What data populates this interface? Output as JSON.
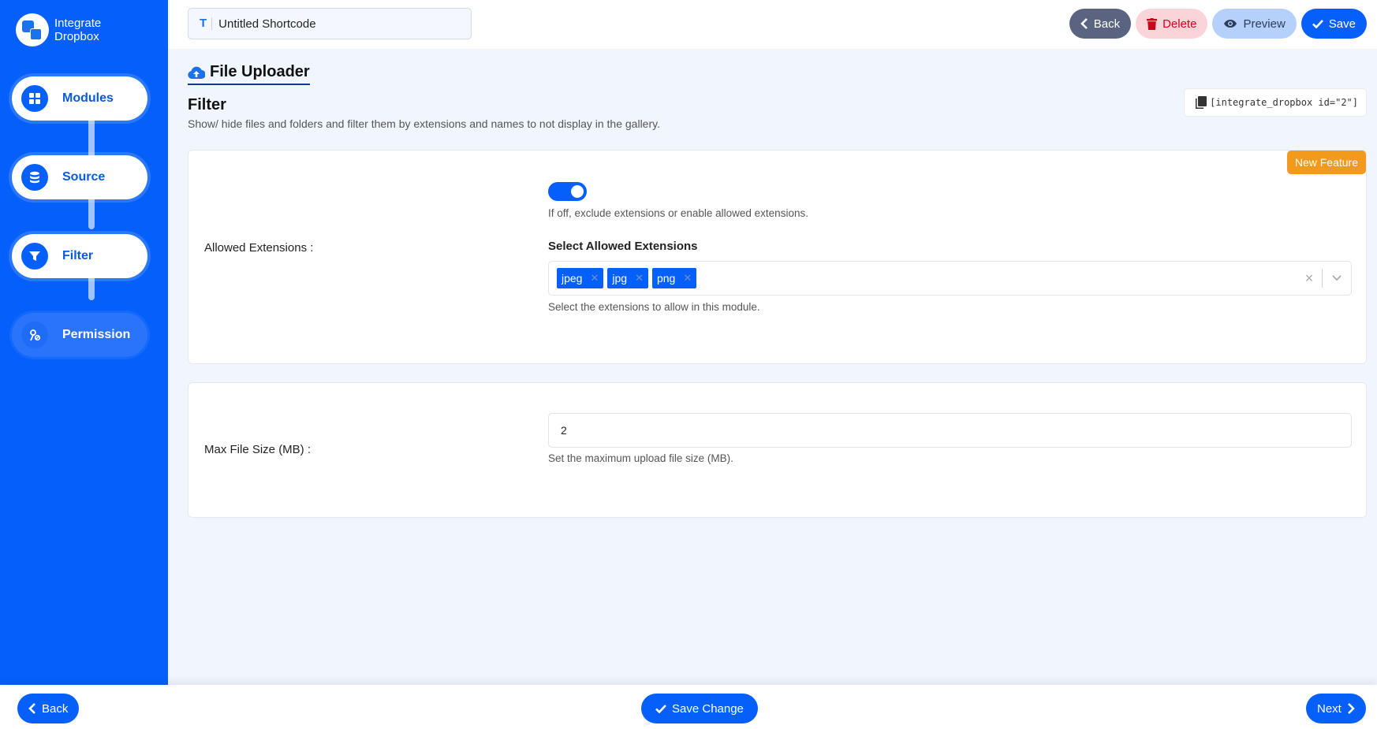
{
  "brand": {
    "name_line1": "Integrate",
    "name_line2": "Dropbox"
  },
  "sidebar": {
    "steps": [
      {
        "label": "Modules",
        "icon": "grid-icon",
        "state": "done"
      },
      {
        "label": "Source",
        "icon": "database-icon",
        "state": "done"
      },
      {
        "label": "Filter",
        "icon": "filter-icon",
        "state": "active"
      },
      {
        "label": "Permission",
        "icon": "user-key-icon",
        "state": "pending"
      }
    ]
  },
  "topbar": {
    "title_value": "Untitled Shortcode",
    "title_icon": "T",
    "back_label": "Back",
    "delete_label": "Delete",
    "preview_label": "Preview",
    "save_label": "Save"
  },
  "main": {
    "module_title": "File Uploader",
    "section_title": "Filter",
    "section_desc": "Show/ hide files and folders and filter them by extensions and names to not display in the gallery.",
    "shortcode": "[integrate_dropbox id=\"2\"]",
    "badge": "New Feature",
    "allowed_extensions": {
      "label": "Allowed Extensions :",
      "toggle_on": true,
      "toggle_help": "If off, exclude extensions or enable allowed extensions.",
      "select_title": "Select Allowed Extensions",
      "chips": [
        "jpeg",
        "jpg",
        "png"
      ],
      "select_help": "Select the extensions to allow in this module."
    },
    "max_file_size": {
      "label": "Max File Size (MB) :",
      "value": "2",
      "help": "Set the maximum upload file size (MB)."
    }
  },
  "footer": {
    "back_label": "Back",
    "save_change_label": "Save Change",
    "next_label": "Next"
  },
  "colors": {
    "primary": "#0560fb",
    "badge": "#f29a1b",
    "delete": "#d0021b"
  }
}
